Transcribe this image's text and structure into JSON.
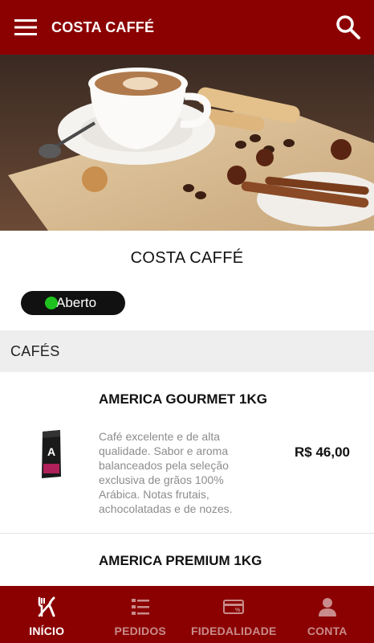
{
  "appbar": {
    "title": "COSTA CAFFÉ",
    "menu_icon": "hamburger-menu-icon",
    "search_icon": "search-icon"
  },
  "store": {
    "name": "COSTA CAFFÉ",
    "status": "Aberto",
    "status_color": "#1ec21e"
  },
  "category": {
    "title": "CAFÉS"
  },
  "products": [
    {
      "name": "AMERICA GOURMET 1KG",
      "description": "Café excelente e de alta qualidade. Sabor e aroma balanceados pela seleção exclusiva de grãos 100% Arábica. Notas frutais, achocolatadas e de nozes.",
      "price": "R$ 46,00"
    },
    {
      "name": "AMERICA PREMIUM 1KG"
    }
  ],
  "bottom_nav": [
    {
      "label": "INÍCIO",
      "icon": "fork-knife-icon",
      "active": true
    },
    {
      "label": "PEDIDOS",
      "icon": "order-list-icon",
      "active": false
    },
    {
      "label": "FIDEDALIDADE",
      "icon": "loyalty-card-icon",
      "active": false
    },
    {
      "label": "CONTA",
      "icon": "user-icon",
      "active": false
    }
  ],
  "colors": {
    "primary": "#8b0000",
    "inactive_nav": "#c98b8b"
  }
}
